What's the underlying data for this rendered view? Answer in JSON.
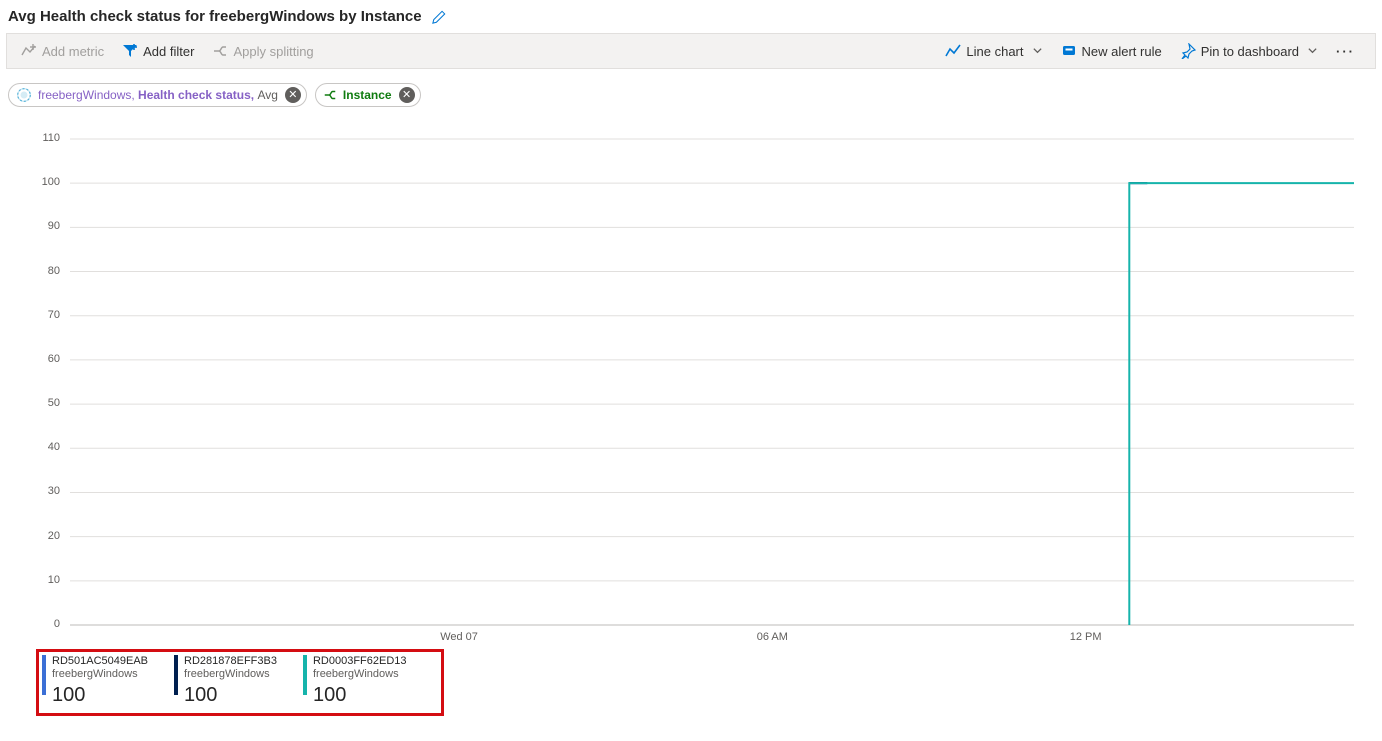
{
  "title": "Avg Health check status for freebergWindows by Instance",
  "toolbar": {
    "add_metric": "Add metric",
    "add_filter": "Add filter",
    "apply_splitting": "Apply splitting",
    "chart_type": "Line chart",
    "new_alert_rule": "New alert rule",
    "pin_to_dashboard": "Pin to dashboard"
  },
  "chips": {
    "resource": "freebergWindows",
    "metric": "Health check status",
    "agg": "Avg",
    "split_by": "Instance"
  },
  "legend": [
    {
      "name": "RD501AC5049EAB",
      "sub": "freebergWindows",
      "value": "100",
      "color": "#3b6fd6"
    },
    {
      "name": "RD281878EFF3B3",
      "sub": "freebergWindows",
      "value": "100",
      "color": "#002050"
    },
    {
      "name": "RD0003FF62ED13",
      "sub": "freebergWindows",
      "value": "100",
      "color": "#16b4ab"
    }
  ],
  "chart_data": {
    "type": "line",
    "title": "Avg Health check status for freebergWindows by Instance",
    "ylabel": "",
    "xlabel": "",
    "ylim": [
      0,
      110
    ],
    "y_ticks": [
      0,
      10,
      20,
      30,
      40,
      50,
      60,
      70,
      80,
      90,
      100,
      110
    ],
    "x_categories": [
      "Wed 07",
      "06 AM",
      "12 PM"
    ],
    "x_axis_positions_pct": [
      30.3,
      54.7,
      79.1
    ],
    "series": [
      {
        "name": "RD501AC5049EAB",
        "color": "#3b6fd6",
        "points_pct": [
          [
            82.5,
            100
          ],
          [
            83.9,
            100
          ]
        ]
      },
      {
        "name": "RD281878EFF3B3",
        "color": "#002050",
        "points_pct": [
          [
            82.5,
            100
          ],
          [
            83.9,
            100
          ]
        ]
      },
      {
        "name": "RD0003FF62ED13",
        "color": "#16b4ab",
        "points_pct": [
          [
            82.5,
            0
          ],
          [
            82.5,
            100
          ],
          [
            100,
            100
          ]
        ]
      }
    ]
  }
}
